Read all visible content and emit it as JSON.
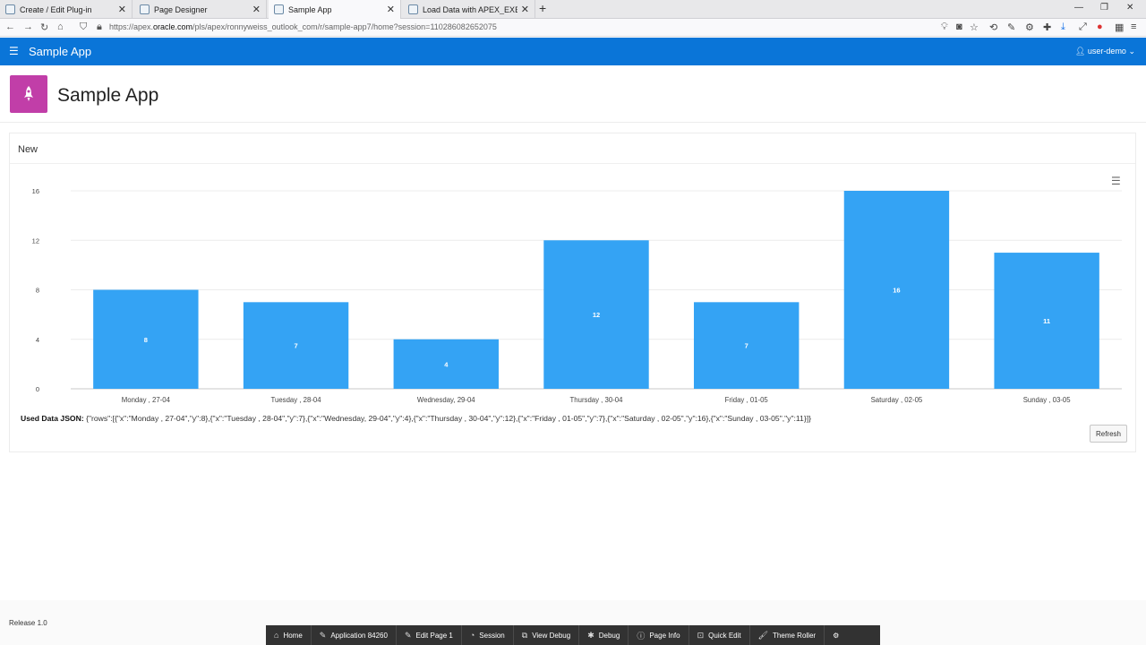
{
  "browser": {
    "tabs": [
      {
        "title": "Create / Edit Plug-in"
      },
      {
        "title": "Page Designer"
      },
      {
        "title": "Sample App"
      },
      {
        "title": "Load Data with APEX_EXEC (Re"
      }
    ],
    "url_prefix": "https://apex.",
    "url_domain": "oracle.com",
    "url_rest": "/pls/apex/ronnyweiss_outlook_com/r/sample-app7/home?session=110286082652075"
  },
  "header": {
    "app_name": "Sample App",
    "user": "user-demo"
  },
  "hero": {
    "title": "Sample App"
  },
  "region": {
    "title": "New",
    "json_label": "Used Data JSON:",
    "json_text": "{\"rows\":[{\"x\":\"Monday , 27-04\",\"y\":8},{\"x\":\"Tuesday , 28-04\",\"y\":7},{\"x\":\"Wednesday, 29-04\",\"y\":4},{\"x\":\"Thursday , 30-04\",\"y\":12},{\"x\":\"Friday , 01-05\",\"y\":7},{\"x\":\"Saturday , 02-05\",\"y\":16},{\"x\":\"Sunday , 03-05\",\"y\":11}]}",
    "refresh_label": "Refresh"
  },
  "chart_data": {
    "type": "bar",
    "categories": [
      "Monday , 27-04",
      "Tuesday , 28-04",
      "Wednesday, 29-04",
      "Thursday , 30-04",
      "Friday , 01-05",
      "Saturday , 02-05",
      "Sunday , 03-05"
    ],
    "values": [
      8,
      7,
      4,
      12,
      7,
      16,
      11
    ],
    "yticks": [
      0,
      4,
      8,
      12,
      16
    ],
    "ylim": [
      0,
      16
    ],
    "bar_color": "#34a3f4",
    "grid": true,
    "data_labels": true
  },
  "footer": {
    "release": "Release 1.0",
    "devbar": [
      {
        "label": "Home",
        "icon": "home-icon"
      },
      {
        "label": "Application 84260",
        "icon": "edit-icon"
      },
      {
        "label": "Edit Page 1",
        "icon": "edit-icon"
      },
      {
        "label": "Session",
        "icon": "session-icon"
      },
      {
        "label": "View Debug",
        "icon": "debug-view-icon"
      },
      {
        "label": "Debug",
        "icon": "bug-icon"
      },
      {
        "label": "Page Info",
        "icon": "info-icon"
      },
      {
        "label": "Quick Edit",
        "icon": "quick-edit-icon"
      },
      {
        "label": "Theme Roller",
        "icon": "brush-icon"
      }
    ]
  }
}
